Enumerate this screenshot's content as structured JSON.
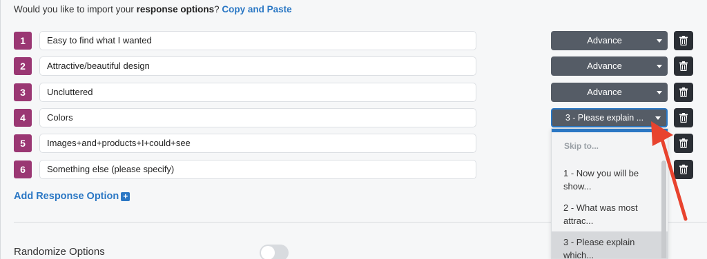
{
  "intro": {
    "prefix": "Would you like to import your ",
    "bold": "response options",
    "suffix": "? ",
    "link": "Copy and Paste"
  },
  "options": [
    {
      "num": "1",
      "text": "Easy to find what I wanted",
      "skip": "Advance"
    },
    {
      "num": "2",
      "text": "Attractive/beautiful design",
      "skip": "Advance"
    },
    {
      "num": "3",
      "text": "Uncluttered",
      "skip": "Advance"
    },
    {
      "num": "4",
      "text": "Colors",
      "skip": "3 - Please explain ..."
    },
    {
      "num": "5",
      "text": "Images+and+products+I+could+see",
      "skip": ""
    },
    {
      "num": "6",
      "text": "Something else (please specify)",
      "skip": ""
    }
  ],
  "add_option_label": "Add Response Option",
  "add_option_icon": "plus-square-icon",
  "randomize_label": "Randomize Options",
  "dropdown": {
    "header": "Skip to...",
    "items": [
      "1 - Now you will be show...",
      "2 - What was most attrac...",
      "3 - Please explain which..."
    ],
    "selected_index": 2
  },
  "colors": {
    "number_badge": "#9a3773",
    "link": "#2a77c4",
    "select_bg": "#555c66",
    "delete_bg": "#2b2f35",
    "arrow": "#e8432e"
  },
  "icons": {
    "delete": "trash-icon",
    "caret": "caret-down-icon",
    "annotation": "red-arrow-icon"
  }
}
